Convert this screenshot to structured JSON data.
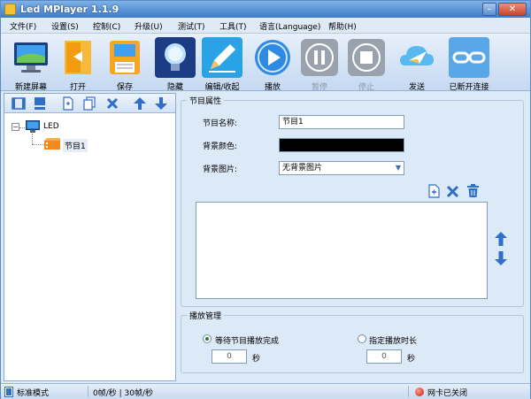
{
  "window": {
    "title": "Led MPlayer 1.1.9",
    "minimize_icon": "minimize-icon",
    "close_icon": "close-icon"
  },
  "menu": [
    {
      "label": "文件(F)"
    },
    {
      "label": "设置(S)"
    },
    {
      "label": "控制(C)"
    },
    {
      "label": "升级(U)"
    },
    {
      "label": "测试(T)"
    },
    {
      "label": "工具(T)"
    },
    {
      "label": "语言(Language)"
    },
    {
      "label": "帮助(H)"
    }
  ],
  "toolbar": [
    {
      "label": "新建屏幕",
      "icon": "monitor-icon"
    },
    {
      "label": "打开",
      "icon": "open-door-icon"
    },
    {
      "label": "保存",
      "icon": "save-icon"
    },
    {
      "label": "隐藏",
      "icon": "lightbulb-icon"
    },
    {
      "label": "编辑/收起",
      "icon": "pencil-icon"
    },
    {
      "label": "播放",
      "icon": "play-icon"
    },
    {
      "label": "暂停",
      "icon": "pause-icon"
    },
    {
      "label": "停止",
      "icon": "stop-icon"
    },
    {
      "label": "发送",
      "icon": "send-cloud-icon"
    },
    {
      "label": "已断开连接",
      "icon": "chain-link-icon"
    }
  ],
  "tree": {
    "root_label": "LED",
    "child_label": "节目1"
  },
  "program_props": {
    "group_title": "节目属性",
    "name_label": "节目名称:",
    "name_value": "节目1",
    "bg_color_label": "背景颜色:",
    "bg_color": "#000000",
    "bg_image_label": "背景图片:",
    "bg_image_value": "无背景图片"
  },
  "playback": {
    "group_title": "播放管理",
    "option_wait_label": "等待节目播放完成",
    "option_wait_value": "0",
    "option_wait_unit": "秒",
    "option_time_label": "指定播放时长",
    "option_time_value": "0",
    "option_time_unit": "秒"
  },
  "status": {
    "mode": "标准模式",
    "frames": "0帧/秒 | 30帧/秒",
    "network": "网卡已关闭"
  },
  "colors": {
    "title_bar": "#3e7cc9",
    "accent_blue": "#2f8ae3",
    "status_red": "#d01a0a"
  }
}
